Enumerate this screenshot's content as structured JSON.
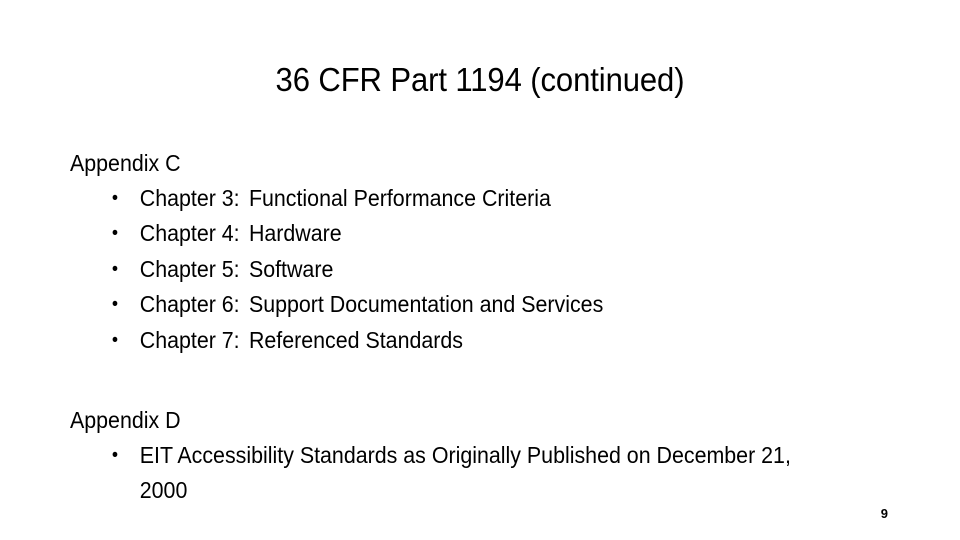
{
  "slide": {
    "title": "36 CFR Part 1194 (continued)",
    "page_number": "9",
    "background_color": "#ffffff",
    "text_color": "#000000",
    "bullet_glyph": "•"
  },
  "sections": [
    {
      "heading": "Appendix C",
      "bullets": [
        {
          "label": "Chapter 3:",
          "text": "Functional Performance Criteria"
        },
        {
          "label": "Chapter 4:",
          "text": "Hardware"
        },
        {
          "label": "Chapter 5:",
          "text": "Software"
        },
        {
          "label": "Chapter 6:",
          "text": "Support Documentation and Services"
        },
        {
          "label": "Chapter 7:",
          "text": "Referenced Standards"
        }
      ]
    },
    {
      "heading": "Appendix D",
      "bullets": [
        {
          "label": "",
          "text": "EIT Accessibility Standards as Originally Published on December 21, 2000"
        }
      ]
    }
  ]
}
